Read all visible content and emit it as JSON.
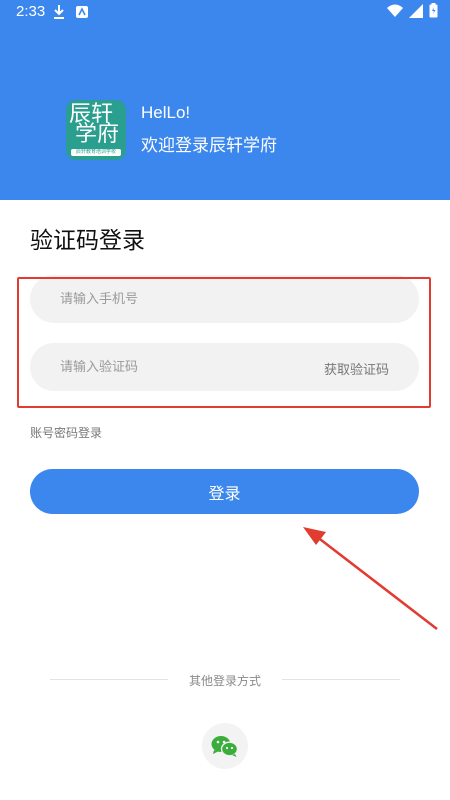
{
  "status_bar": {
    "time": "2:33",
    "left_icons": [
      "download-icon",
      "app-notification-icon"
    ],
    "right_icons": [
      "wifi-icon",
      "signal-icon",
      "battery-icon"
    ]
  },
  "header": {
    "background_color": "#3b87ee",
    "logo": {
      "line1": "辰轩",
      "line2": "学府",
      "strip_text": "辰轩教育培训学校",
      "background_color": "#2a9e8f"
    },
    "greeting": "HelLo!",
    "welcome": "欢迎登录辰轩学府"
  },
  "form": {
    "title": "验证码登录",
    "phone": {
      "placeholder": "请输入手机号",
      "value": ""
    },
    "code": {
      "placeholder": "请输入验证码",
      "value": "",
      "get_code_label": "获取验证码"
    },
    "password_login_link": "账号密码登录",
    "login_button": "登录",
    "highlight_color": "#e23b30"
  },
  "footer": {
    "other_methods_label": "其他登录方式",
    "methods": [
      "wechat-icon"
    ]
  }
}
